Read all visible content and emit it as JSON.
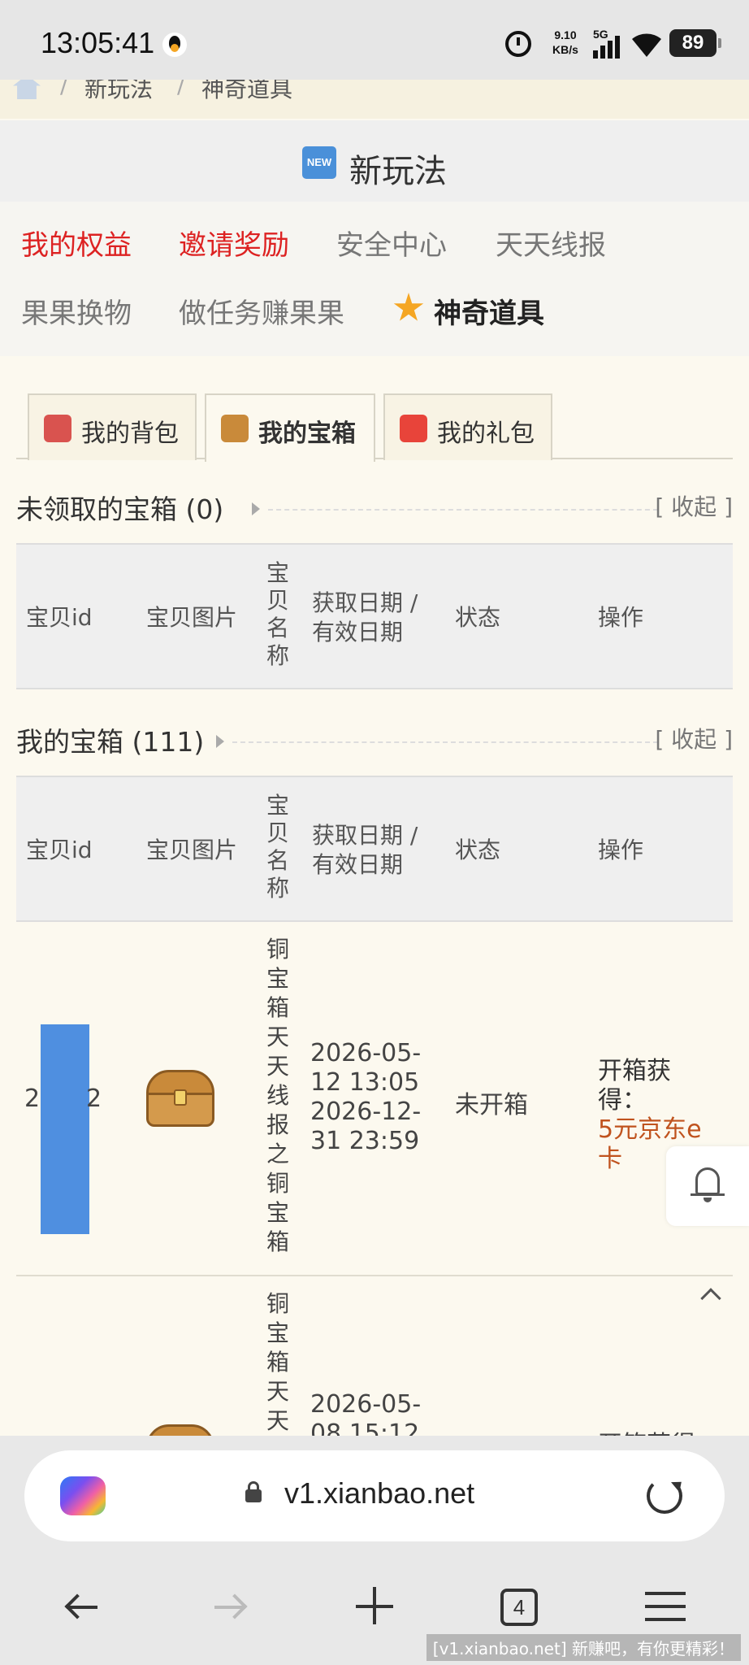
{
  "status_bar": {
    "time": "13:05:41",
    "net_speed_value": "9.10",
    "net_speed_unit": "KB/s",
    "network": "5G",
    "battery": "89"
  },
  "breadcrumb": {
    "items": [
      "新玩法",
      "神奇道具"
    ]
  },
  "section": {
    "badge": "NEW",
    "title": "新玩法"
  },
  "nav": {
    "links": [
      "我的权益",
      "邀请奖励",
      "安全中心",
      "天天线报",
      "果果换物",
      "做任务赚果果",
      "神奇道具"
    ],
    "highlight_color": "#dd2222"
  },
  "tabs": [
    "我的背包",
    "我的宝箱",
    "我的礼包"
  ],
  "unclaimed": {
    "title": "未领取的宝箱 (0)",
    "collapse": "[ 收起 ]"
  },
  "mine": {
    "title": "我的宝箱 (111)",
    "collapse": "[ 收起 ]"
  },
  "columns": {
    "id": "宝贝id",
    "image": "宝贝图片",
    "name": "宝贝名称",
    "date": "获取日期 / 有效日期",
    "status": "状态",
    "action": "操作"
  },
  "rows": [
    {
      "id_start": "2",
      "id_end": "2",
      "name": "铜宝箱天天线报之铜宝箱",
      "date": "2026-05-12 13:05 2026-12-31 23:59",
      "status": "未开箱",
      "reward_label": "开箱获得：",
      "reward_value": "5元京东e卡"
    },
    {
      "name_partial": "铜宝箱天天",
      "date_partial": "2026-05-08 15:12",
      "reward_label_partial": "开箱获得："
    }
  ],
  "browser": {
    "url": "v1.xianbao.net",
    "tab_count": "4"
  },
  "watermark": "[v1.xianbao.net] 新赚吧，有你更精彩！",
  "colors": {
    "reward": "#c0531e",
    "redaction": "#4f8fe0",
    "page_bg": "#fcf9ef"
  }
}
